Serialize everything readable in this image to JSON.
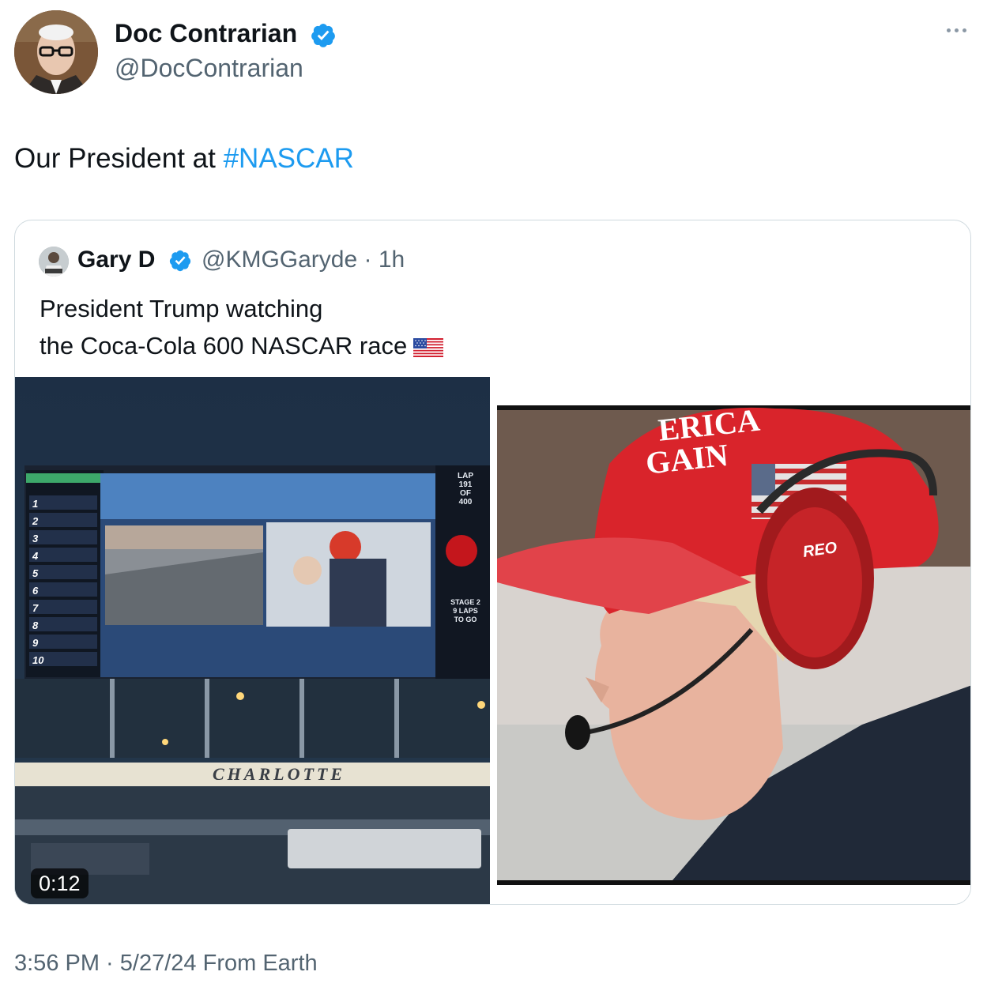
{
  "author": {
    "name": "Doc Contrarian",
    "handle": "@DocContrarian",
    "verified": true
  },
  "tweet": {
    "text_prefix": "Our President at ",
    "hashtag": "#NASCAR"
  },
  "quoted": {
    "name": "Gary D",
    "handle_time": "@KMGGaryde · 1h",
    "text_line1": "President Trump watching",
    "text_line2": "the Coca-Cola 600 NASCAR race",
    "emoji": "us-flag",
    "media": {
      "video_duration": "0:12",
      "video_scene_text": {
        "lap_label": "LAP",
        "lap_value": "191",
        "of_label": "OF",
        "lap_total": "400",
        "stage_label": "STAGE 2",
        "laps_to_go_line1": "9 LAPS",
        "laps_to_go_line2": "TO GO",
        "track_banner": "CHARLOTTE",
        "leaderboard_positions": [
          "1",
          "2",
          "3",
          "4",
          "5",
          "6",
          "7",
          "8",
          "9",
          "10"
        ]
      },
      "photo_scene_text": {
        "hat_line1": "ERICA",
        "hat_line2": "GAIN",
        "headset_brand": "REO"
      }
    }
  },
  "footer": {
    "time": "3:56 PM",
    "separator": " · ",
    "date": "5/27/24",
    "source": "From Earth"
  },
  "colors": {
    "link": "#1d9bf0",
    "secondary_text": "#536471",
    "verified": "#1d9bf0",
    "border": "#cfd9de"
  }
}
